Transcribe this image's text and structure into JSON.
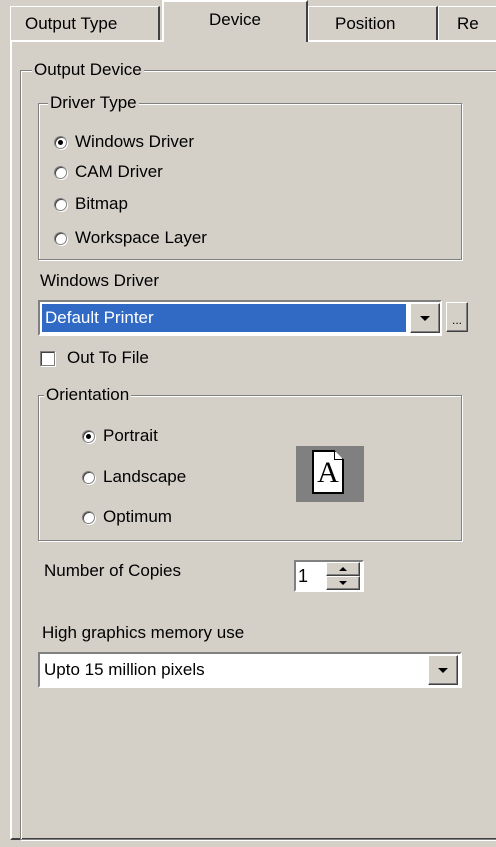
{
  "tabs": [
    {
      "label": "Output Type"
    },
    {
      "label": "Device"
    },
    {
      "label": "Position"
    },
    {
      "label": "Re"
    }
  ],
  "output_device": {
    "title": "Output Device",
    "driver_type": {
      "title": "Driver Type",
      "options": [
        {
          "label": "Windows Driver",
          "selected": true
        },
        {
          "label": "CAM Driver",
          "selected": false
        },
        {
          "label": "Bitmap",
          "selected": false
        },
        {
          "label": "Workspace Layer",
          "selected": false
        }
      ]
    },
    "windows_driver": {
      "label": "Windows Driver",
      "value": "Default Printer",
      "browse_label": "..."
    },
    "out_to_file": {
      "label": "Out To File",
      "checked": false
    },
    "orientation": {
      "title": "Orientation",
      "options": [
        {
          "label": "Portrait",
          "selected": true
        },
        {
          "label": "Landscape",
          "selected": false
        },
        {
          "label": "Optimum",
          "selected": false
        }
      ],
      "preview_glyph": "A"
    },
    "copies": {
      "label": "Number of Copies",
      "value": "1"
    },
    "graphics_memory": {
      "label": "High graphics memory use",
      "value": "Upto 15 million pixels"
    }
  },
  "colors": {
    "face": "#d4d0c8",
    "selection": "#316ac5"
  }
}
